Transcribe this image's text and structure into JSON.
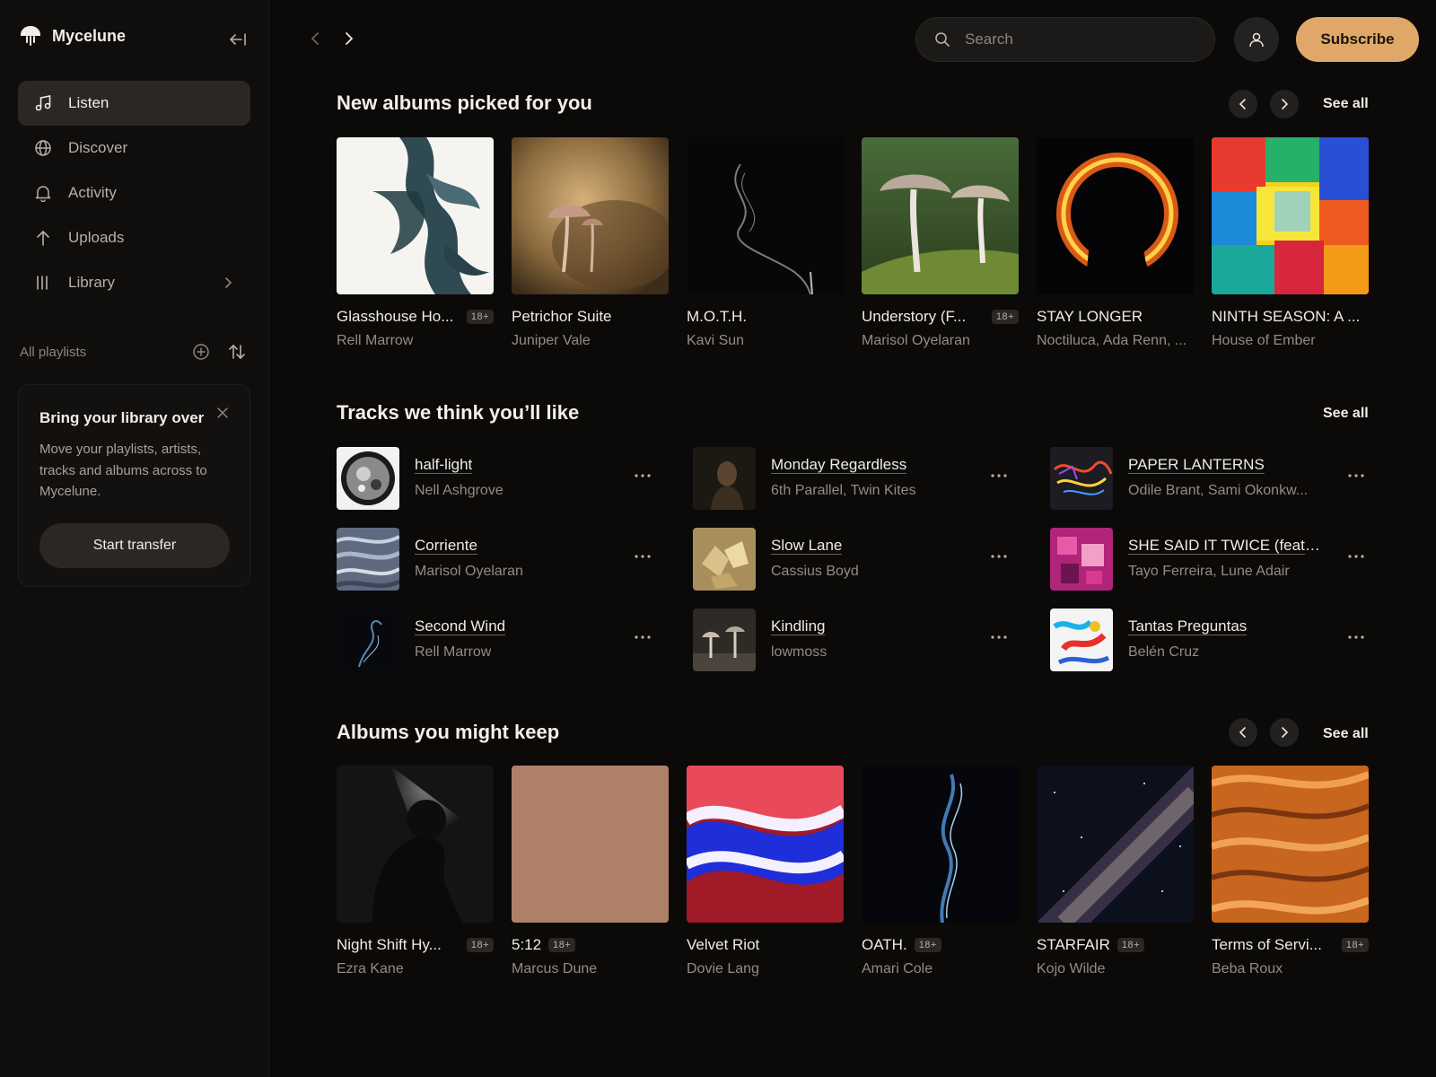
{
  "app": {
    "name": "Mycelune"
  },
  "sidebar": {
    "nav": [
      {
        "label": "Listen",
        "icon": "music-note-icon",
        "active": true
      },
      {
        "label": "Discover",
        "icon": "globe-icon"
      },
      {
        "label": "Activity",
        "icon": "bell-icon"
      },
      {
        "label": "Uploads",
        "icon": "upload-arrow-icon"
      },
      {
        "label": "Library",
        "icon": "library-icon"
      }
    ],
    "playlists_label": "All playlists",
    "transfer": {
      "title": "Bring your library over",
      "body": "Move your playlists, artists, tracks and albums across to Mycelune.",
      "button": "Start transfer"
    }
  },
  "topbar": {
    "search_placeholder": "Search",
    "subscribe": "Subscribe"
  },
  "sections": {
    "new_albums": {
      "title": "New albums picked for you",
      "see_all": "See all",
      "albums": [
        {
          "title": "Glasshouse Ho...",
          "artist": "Rell Marrow",
          "badge": "18+"
        },
        {
          "title": "Petrichor Suite",
          "artist": "Juniper Vale",
          "badge": ""
        },
        {
          "title": "M.O.T.H.",
          "artist": "Kavi Sun",
          "badge": ""
        },
        {
          "title": "Understory (F...",
          "artist": "Marisol Oyelaran",
          "badge": "18+"
        },
        {
          "title": "STAY LONGER",
          "artist": "Noctiluca, Ada Renn, ...",
          "badge": ""
        },
        {
          "title": "NINTH SEASON: A ...",
          "artist": "House of Ember",
          "badge": ""
        }
      ]
    },
    "tracks": {
      "title": "Tracks we think you’ll like",
      "see_all": "See all",
      "items": [
        {
          "name": "half-light",
          "artist": "Nell Ashgrove"
        },
        {
          "name": "Monday Regardless",
          "artist": "6th Parallel, Twin Kites"
        },
        {
          "name": "PAPER LANTERNS",
          "artist": "Odile Brant, Sami Okonkw..."
        },
        {
          "name": "Corriente",
          "artist": "Marisol Oyelaran"
        },
        {
          "name": "Slow Lane",
          "artist": "Cassius Boyd"
        },
        {
          "name": "SHE SAID IT TWICE (feat....",
          "artist": "Tayo Ferreira, Lune Adair"
        },
        {
          "name": "Second Wind",
          "artist": "Rell Marrow"
        },
        {
          "name": "Kindling",
          "artist": "lowmoss"
        },
        {
          "name": "Tantas Preguntas",
          "artist": "Belén Cruz"
        }
      ]
    },
    "keep_albums": {
      "title": "Albums you might keep",
      "see_all": "See all",
      "albums": [
        {
          "title": "Night Shift Hy...",
          "artist": "Ezra Kane",
          "badge": "18+"
        },
        {
          "title": "5:12",
          "artist": "Marcus Dune",
          "badge": "18+"
        },
        {
          "title": "Velvet Riot",
          "artist": "Dovie Lang",
          "badge": ""
        },
        {
          "title": "OATH.",
          "artist": "Amari Cole",
          "badge": "18+"
        },
        {
          "title": "STARFAIR",
          "artist": "Kojo Wilde",
          "badge": "18+"
        },
        {
          "title": "Terms of Servi...",
          "artist": "Beba Roux",
          "badge": "18+"
        }
      ]
    }
  },
  "colors": {
    "accent": "#e0a868",
    "background": "#0b0a09",
    "sidebar": "#0f0e0d"
  }
}
